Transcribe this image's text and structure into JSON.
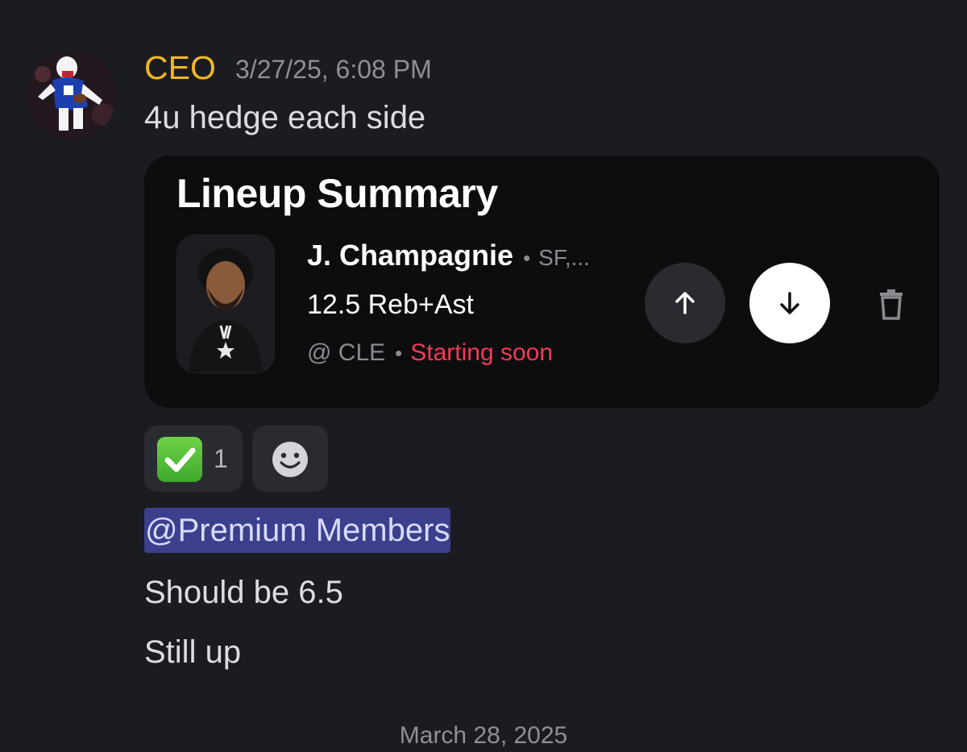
{
  "message": {
    "username": "CEO",
    "timestamp": "3/27/25, 6:08 PM",
    "text": "4u hedge each side"
  },
  "lineup_card": {
    "title": "Lineup Summary",
    "player_name": "J. Champagnie",
    "separator": "•",
    "position": "SF,...",
    "prop": "12.5 Reb+Ast",
    "opponent": "@ CLE",
    "status": "Starting soon",
    "icons": {
      "more": "arrow-up-icon",
      "less": "arrow-down-icon",
      "delete": "trash-icon"
    },
    "colors": {
      "status": "#f23b55",
      "selected_button": "#ffffff"
    }
  },
  "reactions": [
    {
      "emoji": "check-mark-icon",
      "count": "1"
    },
    {
      "emoji": "add-reaction-icon"
    }
  ],
  "mention": "@Premium Members",
  "followups": [
    "Should be 6.5",
    "Still up"
  ],
  "date_divider": "March 28, 2025",
  "colors": {
    "background": "#1b1c21",
    "username": "#f0b623",
    "mention_bg": "#3c3f8c"
  }
}
